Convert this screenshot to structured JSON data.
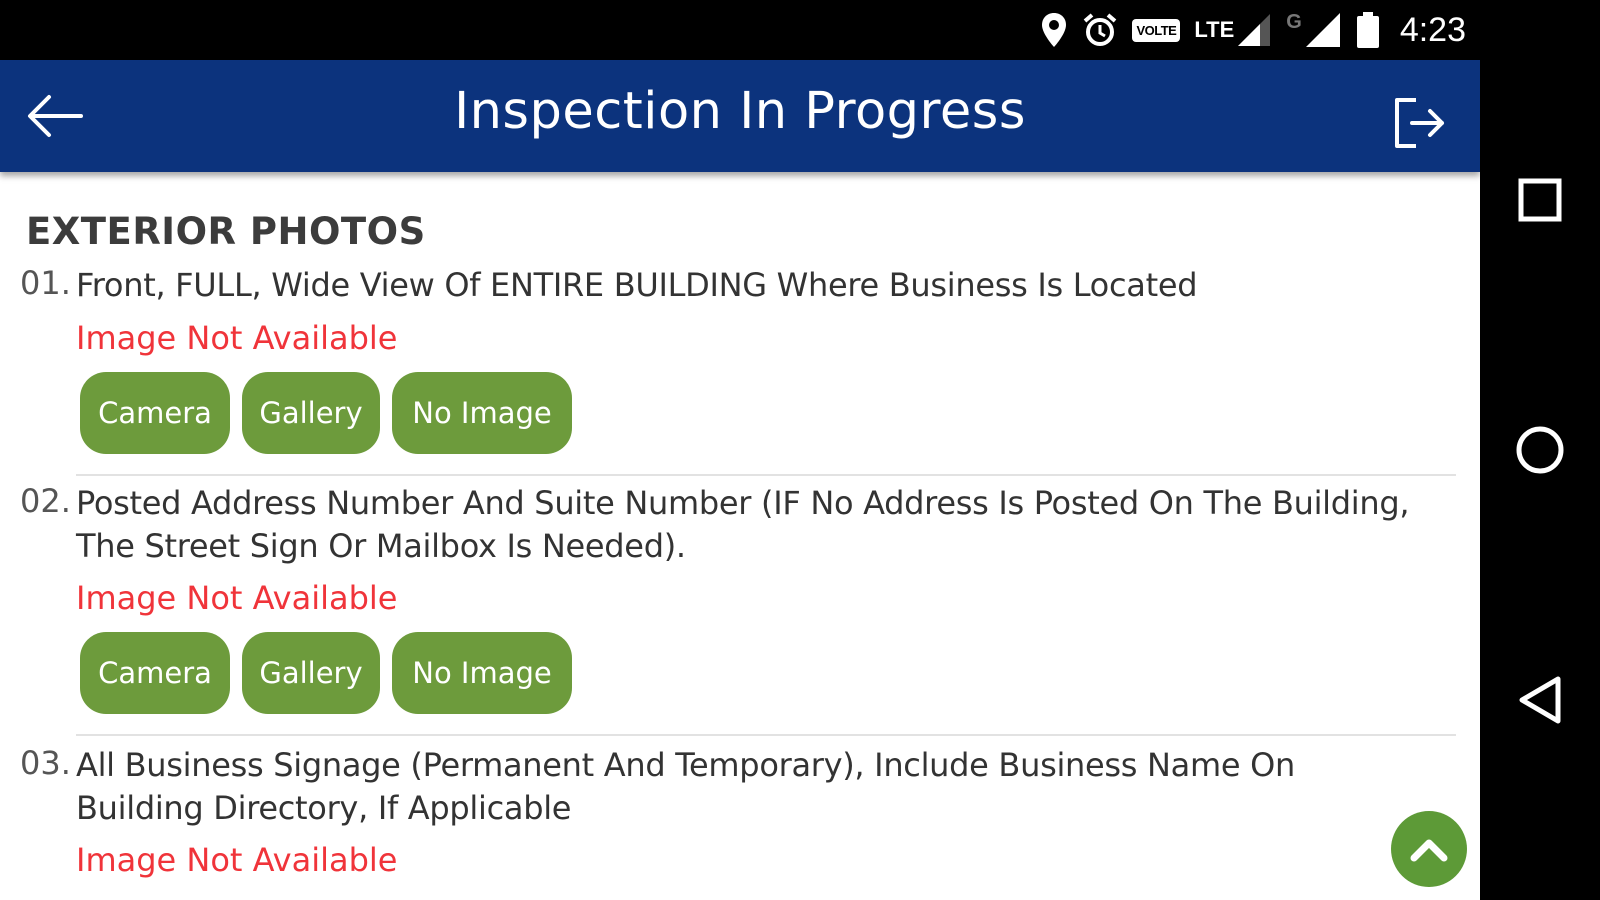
{
  "status_bar": {
    "time": "4:23",
    "volte_label": "VOLTE",
    "lte_label": "LTE",
    "g_label": "G",
    "icons": [
      "location-icon",
      "alarm-icon",
      "volte-icon",
      "lte-signal-icon",
      "g-signal-icon",
      "battery-icon"
    ]
  },
  "app_bar": {
    "title": "Inspection In Progress",
    "back_icon": "arrow-left-icon",
    "logout_icon": "logout-icon"
  },
  "section": {
    "title": "EXTERIOR PHOTOS"
  },
  "items": [
    {
      "number": "01.",
      "text": "Front, FULL, Wide View Of ENTIRE BUILDING Where Business Is Located",
      "status": "Image Not Available",
      "buttons": {
        "camera": "Camera",
        "gallery": "Gallery",
        "no_image": "No Image"
      }
    },
    {
      "number": "02.",
      "text": "Posted Address Number And Suite Number (IF No Address Is Posted On The Building, The Street Sign Or Mailbox Is Needed).",
      "status": "Image Not Available",
      "buttons": {
        "camera": "Camera",
        "gallery": "Gallery",
        "no_image": "No Image"
      }
    },
    {
      "number": "03.",
      "text": "All Business Signage (Permanent And Temporary), Include Business Name On Building Directory, If Applicable",
      "status": "Image Not Available"
    }
  ],
  "colors": {
    "app_bar": "#0c337d",
    "button_green": "#6d9b3c",
    "status_red": "#f0343a",
    "fab_green": "#5d9a37"
  },
  "nav_bar": {
    "icons": [
      "recents-square-icon",
      "home-circle-icon",
      "back-triangle-icon"
    ]
  }
}
